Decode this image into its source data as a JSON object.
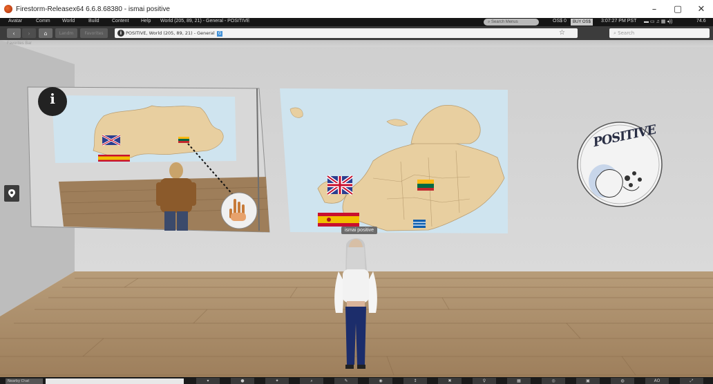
{
  "window": {
    "title": "Firestorm-Releasex64 6.6.8.68380 - ismai positive",
    "controls": [
      "–",
      "▢",
      "✕"
    ]
  },
  "menubar": {
    "items": [
      "Avatar",
      "Comm",
      "World",
      "Build",
      "Content",
      "Help"
    ],
    "region_info": "World (205, 89, 21) - General - POSITIVE",
    "search_placeholder": "Search Menus",
    "balance": "OS$ 0",
    "buy_label": "BUY OS$",
    "time": "3:07:27 PM PST",
    "fps": "74.6"
  },
  "navbar": {
    "home_label": "⌂",
    "ghost_buttons": [
      "Landm",
      "Favorites"
    ],
    "location": "POSITIVE, World (205, 89, 21) - General",
    "location_tag": "G",
    "search_placeholder": "Search",
    "star": "☆"
  },
  "scene": {
    "favorites_bar": "Favorites Bar",
    "avatar_tooltip": "ismai positive",
    "poster_text": "POSITIVE",
    "info_symbol": "i"
  },
  "bottombar": {
    "chat_label": "Nearby Chat",
    "tool_labels": [
      "AO"
    ]
  },
  "colors": {
    "sky_wall": "#d2d2d2",
    "floor": "#a88a66",
    "map_sea": "#cfe4ef",
    "map_land": "#e8cfa0",
    "toolbar_dark": "#1a1a1a"
  }
}
